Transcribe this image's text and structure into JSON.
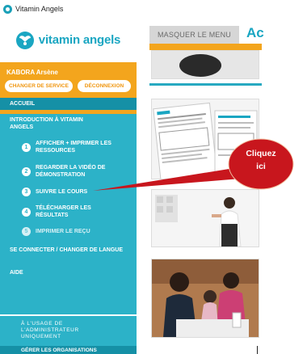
{
  "window": {
    "title": "Vitamin Angels"
  },
  "brand": {
    "name": "vitamin angels"
  },
  "user": {
    "name": "KABORA Arsène",
    "change_service": "CHANGER DE SERVICE",
    "logout": "DÉCONNEXION"
  },
  "menu": {
    "home": "ACCUEIL",
    "intro": "INTRODUCTION À VITAMIN ANGELS",
    "steps": [
      {
        "num": "1",
        "label": "AFFICHER + IMPRIMER LES RESSOURCES"
      },
      {
        "num": "2",
        "label": "REGARDER LA VIDÉO DE DÉMONSTRATION"
      },
      {
        "num": "3",
        "label": "SUIVRE LE COURS"
      },
      {
        "num": "4",
        "label": "TÉLÉCHARGER LES RÉSULTATS"
      },
      {
        "num": "5",
        "label": "IMPRIMER LE REÇU"
      }
    ],
    "connect": "SE CONNECTER / CHANGER DE LANGUE",
    "help": "AIDE"
  },
  "admin": {
    "label": "À L'USAGE DE L'ADMINISTRATEUR UNIQUEMENT",
    "manage": "GÉRER LES ORGANISATIONS"
  },
  "main": {
    "hide_menu": "MASQUER LE MENU",
    "heading": "Ac"
  },
  "callout": {
    "text": "Cliquez ici"
  },
  "colors": {
    "sidebar": "#2cb2c8",
    "sidebar_active": "#1590a6",
    "orange": "#f3a51d",
    "callout_fill": "#c8161d"
  }
}
